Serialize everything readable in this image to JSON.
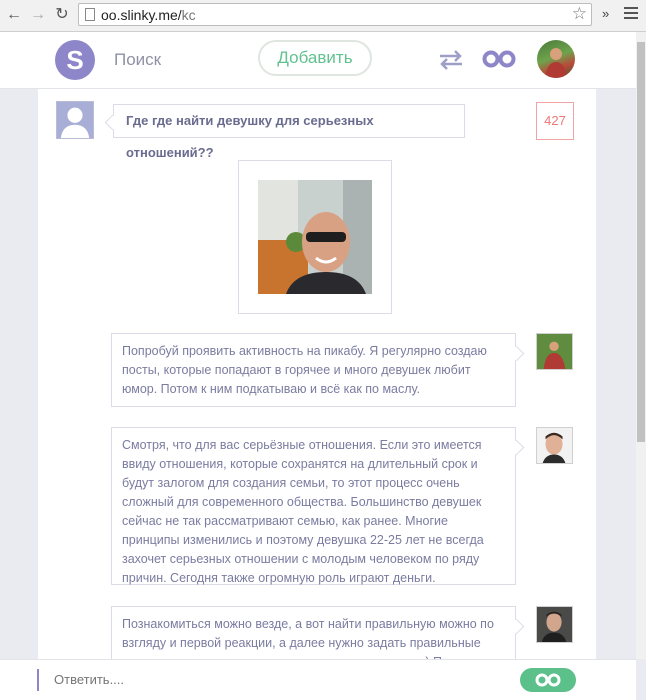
{
  "browser": {
    "url_host": "oo.slinky.me/",
    "url_path": "kc",
    "ext_label": "»"
  },
  "header": {
    "logo_letter": "S",
    "search_label": "Поиск",
    "add_label": "Добавить"
  },
  "question": {
    "text": "Где где найти девушку для серьезных отношений??",
    "count": "427"
  },
  "answers": [
    {
      "text": "Попробуй проявить активность на пикабу. Я регулярно создаю посты, которые попадают в горячее и много девушек любит юмор. Потом к ним подкатываю и всё как по маслу."
    },
    {
      "text": "Смотря, что для вас серьёзные отношения. Если это имеется ввиду отношения, которые сохранятся на длительный срок и будут залогом для создания семьи, то этот процесс очень сложный для современного общества. Большинство девушек сейчас не так рассматривают семью, как ранее. Многие принципы изменились и поэтому девушка 22-25 лет не всегда захочет серьезных отношении с молодым человеком по ряду причин. Сегодня также огромную роль играют деньги."
    },
    {
      "text": "Познакомиться можно везде, а вот найти правильную можно по взгляду и первой реакции, а далее нужно задать правильные вопросы и определить серьезность и порядочность ) П..."
    }
  ],
  "reply": {
    "placeholder": "Ответить...."
  },
  "colors": {
    "brand": "#8d86c9",
    "accent_green": "#5cc08b",
    "count_red": "#ee7878"
  }
}
